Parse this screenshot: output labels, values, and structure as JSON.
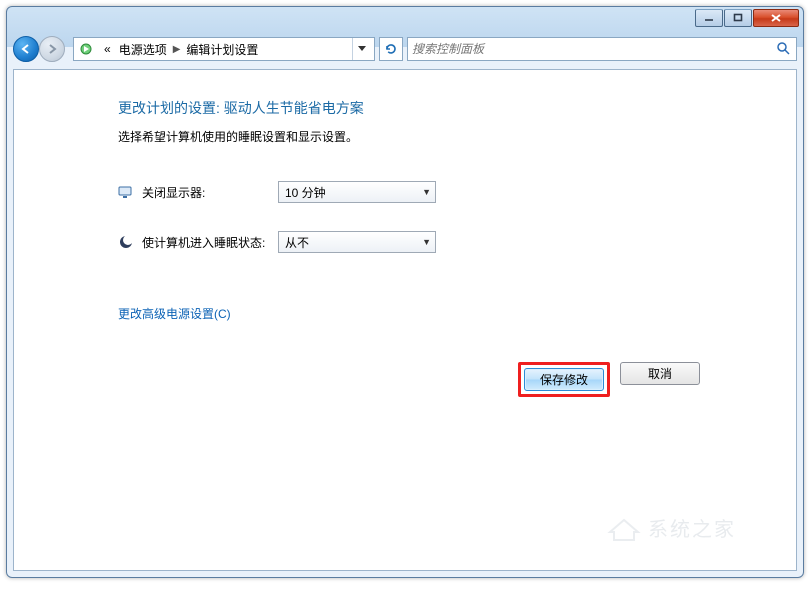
{
  "titlebar": {},
  "breadcrumb": {
    "prefix": "«",
    "items": [
      "电源选项",
      "编辑计划设置"
    ]
  },
  "search": {
    "placeholder": "搜索控制面板"
  },
  "page": {
    "title": "更改计划的设置: 驱动人生节能省电方案",
    "subtitle": "选择希望计算机使用的睡眠设置和显示设置。"
  },
  "settings": {
    "display_off": {
      "label": "关闭显示器:",
      "value": "10 分钟"
    },
    "sleep": {
      "label": "使计算机进入睡眠状态:",
      "value": "从不"
    }
  },
  "links": {
    "advanced": "更改高级电源设置(C)"
  },
  "buttons": {
    "save": "保存修改",
    "cancel": "取消"
  },
  "watermark": "系统之家"
}
